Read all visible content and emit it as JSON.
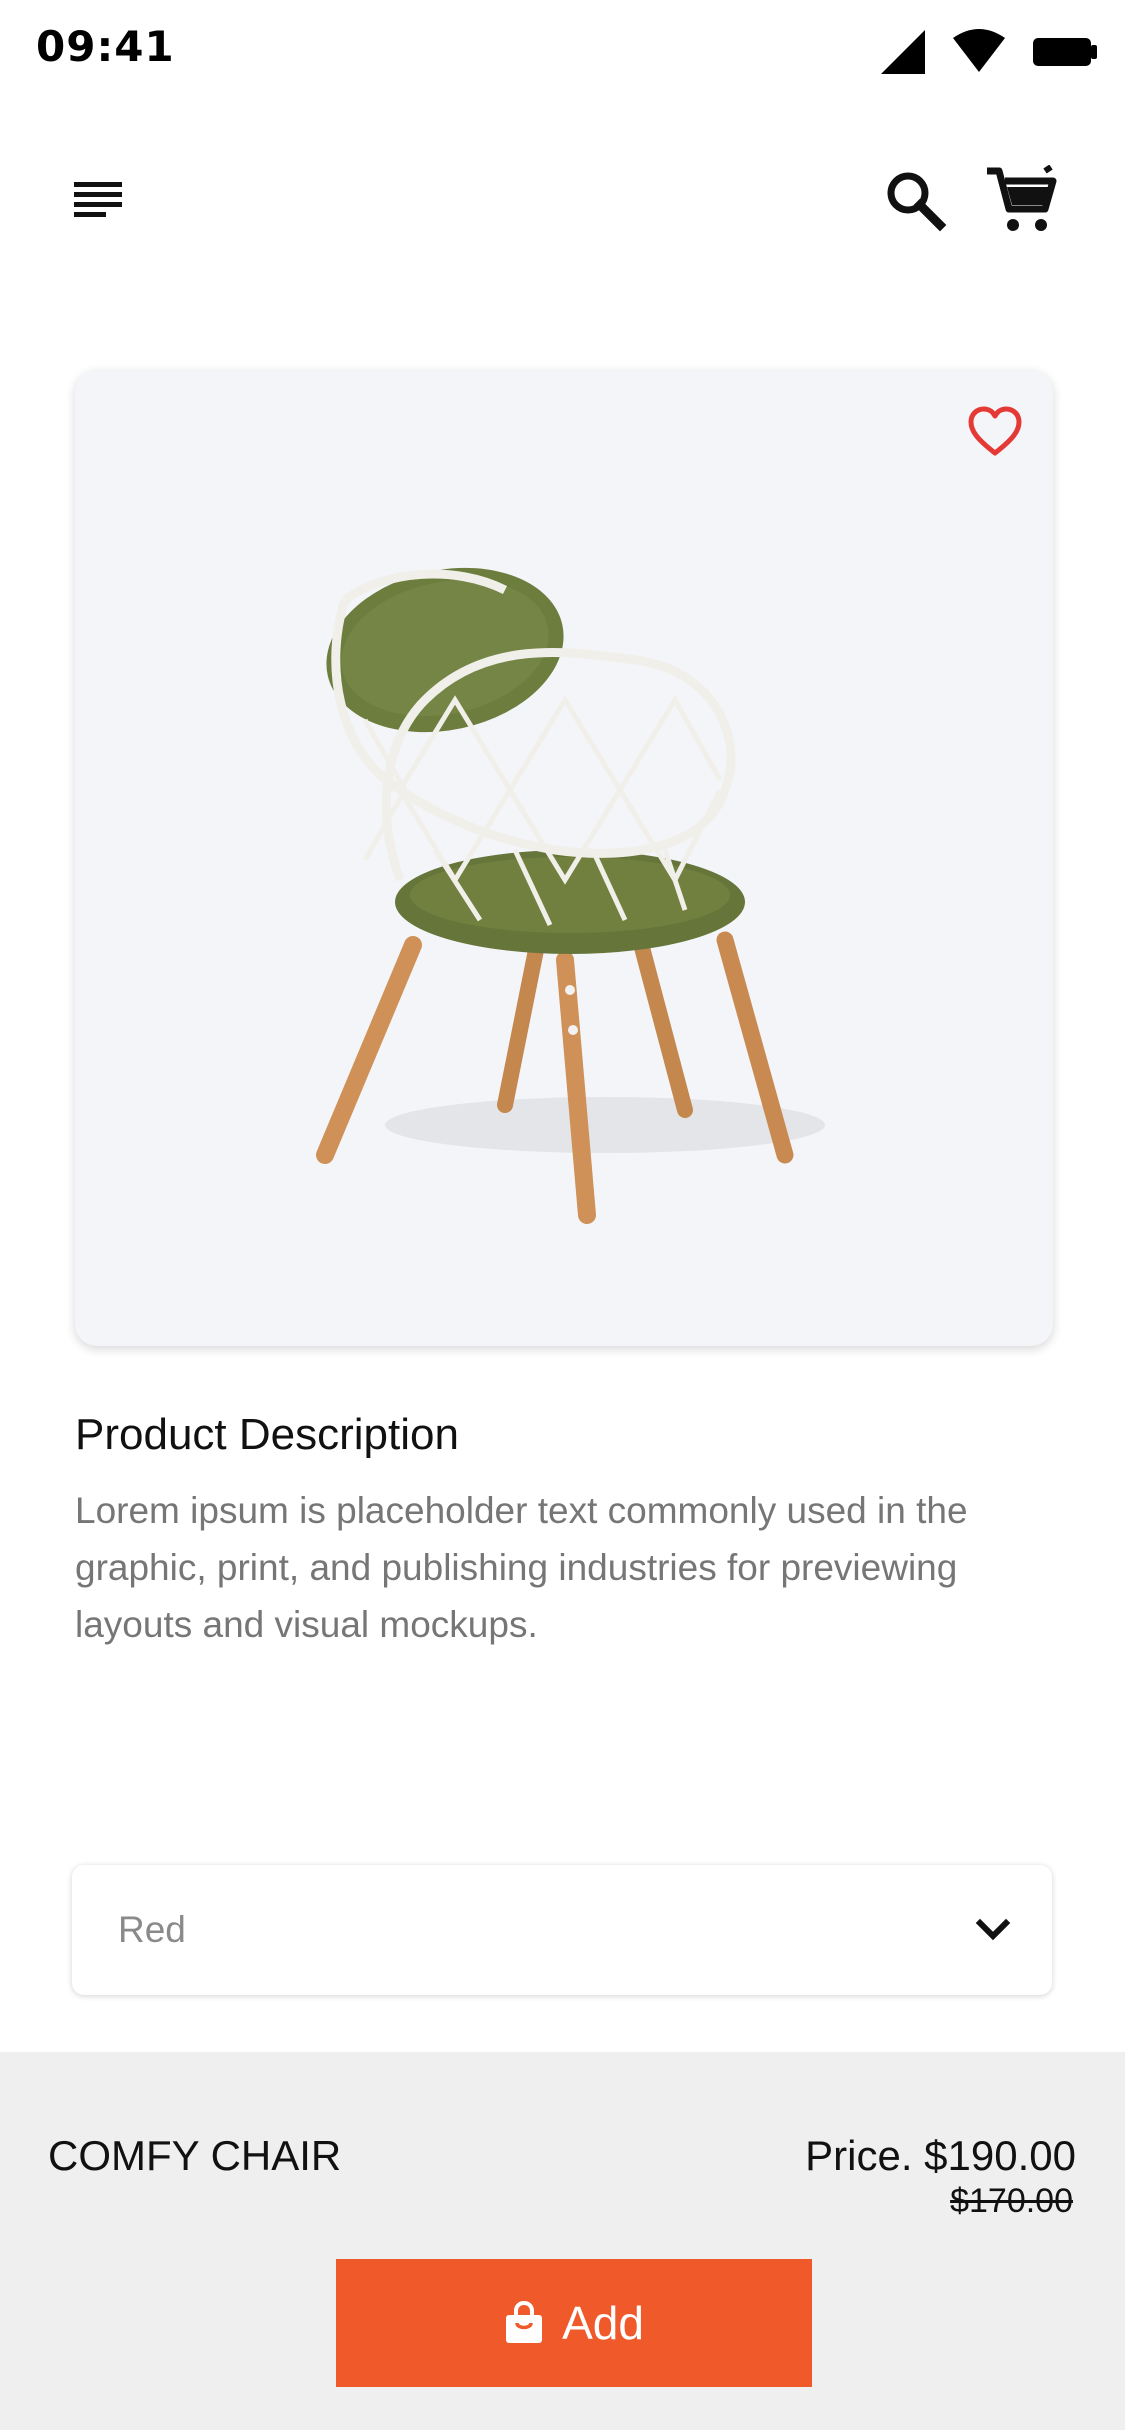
{
  "status_bar": {
    "time": "09:41",
    "icons": [
      "cell-signal-icon",
      "wifi-icon",
      "battery-icon"
    ]
  },
  "app_bar": {
    "icons": [
      "menu-icon",
      "search-icon",
      "cart-icon"
    ]
  },
  "product": {
    "favorite_icon": "heart-outline-icon",
    "favorite_color": "#e53935",
    "description_title": "Product Description",
    "description": "Lorem ipsum is placeholder text commonly used in the graphic, print, and publishing industries for previewing layouts and visual mockups.",
    "color_select": {
      "value": "Red"
    },
    "name": "COMFY CHAIR",
    "price": "Price. $190.00",
    "old_price": "$170.00",
    "add_button": {
      "label": "Add",
      "icon": "shopping-bag-icon",
      "color": "#f05a2a"
    }
  }
}
